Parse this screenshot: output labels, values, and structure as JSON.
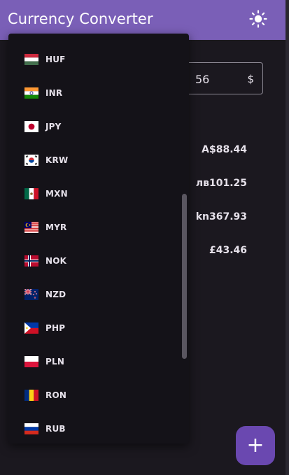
{
  "appbar": {
    "title": "Currency Converter",
    "background": "#7a5fb7",
    "theme_icon": "sun-icon"
  },
  "converter": {
    "amount_value": "56",
    "amount_suffix": "$",
    "results": [
      {
        "id": "aud",
        "value": "A$88.44"
      },
      {
        "id": "bgn",
        "value": "лв101.25"
      },
      {
        "id": "hrk",
        "value": "kn367.93"
      },
      {
        "id": "gbp",
        "value": "£43.46"
      }
    ]
  },
  "dropdown": {
    "items": [
      {
        "code": "HUF",
        "flag": "hungary-flag-icon"
      },
      {
        "code": "INR",
        "flag": "india-flag-icon"
      },
      {
        "code": "JPY",
        "flag": "japan-flag-icon"
      },
      {
        "code": "KRW",
        "flag": "south-korea-flag-icon"
      },
      {
        "code": "MXN",
        "flag": "mexico-flag-icon"
      },
      {
        "code": "MYR",
        "flag": "malaysia-flag-icon"
      },
      {
        "code": "NOK",
        "flag": "norway-flag-icon"
      },
      {
        "code": "NZD",
        "flag": "new-zealand-flag-icon"
      },
      {
        "code": "PHP",
        "flag": "philippines-flag-icon"
      },
      {
        "code": "PLN",
        "flag": "poland-flag-icon"
      },
      {
        "code": "RON",
        "flag": "romania-flag-icon"
      },
      {
        "code": "RUB",
        "flag": "russia-flag-icon"
      }
    ]
  },
  "fab": {
    "label": "+",
    "color": "#6a48b0",
    "icon": "plus-icon"
  }
}
